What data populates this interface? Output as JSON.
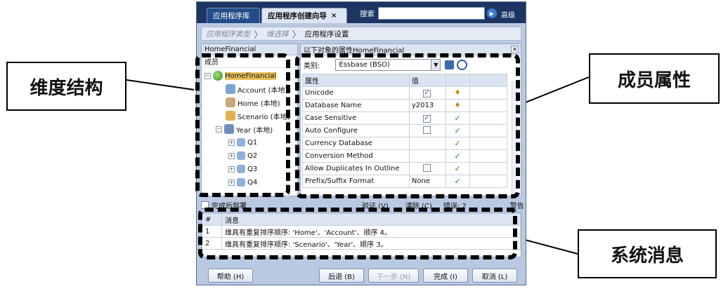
{
  "tabs": {
    "library": "应用程序库",
    "wizard": "应用程序创建向导",
    "close_symbol": "×"
  },
  "search": {
    "label": "搜索",
    "value": "",
    "advanced": "高级"
  },
  "breadcrumb": {
    "step1": "应用程序类型",
    "step2": "维选择",
    "step3": "应用程序设置",
    "separator": "〉"
  },
  "left_panel": {
    "title": "HomeFinancial",
    "header": "成员",
    "tree": [
      {
        "label": "HomeFinancial",
        "toggle": "−",
        "icon": "dimension-root-icon"
      },
      {
        "label": "Account (本地)",
        "toggle": "",
        "icon": "account-dimension-icon"
      },
      {
        "label": "Home (本地)",
        "toggle": "",
        "icon": "home-dimension-icon"
      },
      {
        "label": "Scenario (本地)",
        "toggle": "",
        "icon": "scenario-dimension-icon"
      },
      {
        "label": "Year (本地)",
        "toggle": "−",
        "icon": "year-dimension-icon"
      },
      {
        "label": "Q1",
        "toggle": "+",
        "icon": "member-icon"
      },
      {
        "label": "Q2",
        "toggle": "+",
        "icon": "member-icon"
      },
      {
        "label": "Q3",
        "toggle": "+",
        "icon": "member-icon"
      },
      {
        "label": "Q4",
        "toggle": "+",
        "icon": "member-icon"
      }
    ]
  },
  "right_panel": {
    "title": "以下对象的属性HomeFinancial",
    "category_label": "类别:",
    "category_value": "Essbase (BSO)",
    "col_property": "属性",
    "col_value": "值",
    "rows": [
      {
        "name": "Unicode",
        "checkbox": true,
        "checked": true,
        "value": "",
        "status": "lock"
      },
      {
        "name": "Database Name",
        "checkbox": false,
        "checked": false,
        "value": "y2013",
        "status": "lock"
      },
      {
        "name": "Case Sensitive",
        "checkbox": true,
        "checked": true,
        "value": "",
        "status": "ok"
      },
      {
        "name": "Auto Configure",
        "checkbox": true,
        "checked": false,
        "value": "",
        "status": "ok"
      },
      {
        "name": "Currency Database",
        "checkbox": false,
        "checked": false,
        "value": "",
        "status": "ok"
      },
      {
        "name": "Conversion Method",
        "checkbox": false,
        "checked": false,
        "value": "",
        "status": "ok"
      },
      {
        "name": "Allow Duplicates In Outline",
        "checkbox": true,
        "checked": false,
        "value": "",
        "status": "ok"
      },
      {
        "name": "Prefix/Suffix Format",
        "checkbox": false,
        "checked": false,
        "value": "None",
        "status": "ok"
      }
    ]
  },
  "status_bar": {
    "deploy_label": "完成后部署",
    "validate": "验证 (V)",
    "clear": "清除 (C)",
    "errors": "错误: 2",
    "warning": "警告"
  },
  "messages": {
    "col_num": "#",
    "col_msg": "消息",
    "rows": [
      {
        "num": "1",
        "text": "维具有重复排序顺序: 'Home'、'Account'、顺序 4。"
      },
      {
        "num": "2",
        "text": "维具有重复排序顺序: 'Scenario'、'Year'、顺序 3。"
      }
    ]
  },
  "buttons": {
    "help": "帮助 (H)",
    "back": "后退 (B)",
    "next": "下一步 (N)",
    "finish": "完成 (I)",
    "cancel": "取消 (L)"
  },
  "callouts": {
    "dimension_structure": "维度结构",
    "member_properties": "成员属性",
    "system_messages": "系统消息"
  }
}
